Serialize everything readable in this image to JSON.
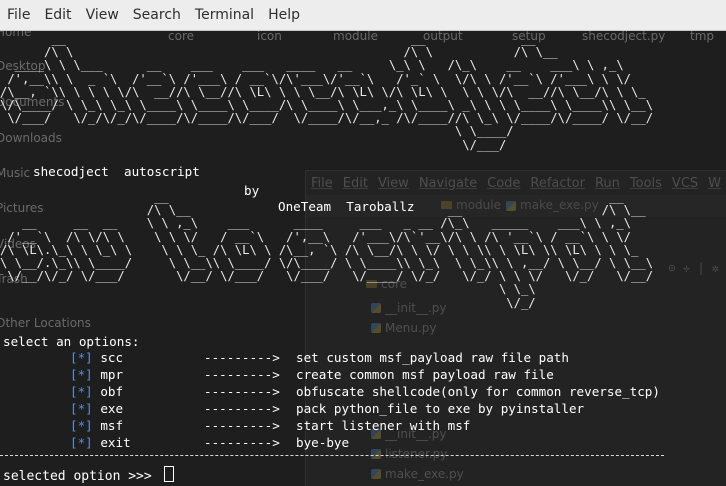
{
  "menu": [
    "File",
    "Edit",
    "View",
    "Search",
    "Terminal",
    "Help"
  ],
  "ghost_file_manager": {
    "sidebar": [
      "Home",
      "Desktop",
      "Documents",
      "Downloads",
      "Music",
      "Pictures",
      "Videos",
      "Trash",
      "Other Locations"
    ],
    "folders": [
      "core",
      "icon",
      "module",
      "output",
      "setup",
      "shecodject.py",
      "tmp"
    ]
  },
  "ghost_ide": {
    "menu": [
      "File",
      "Edit",
      "View",
      "Navigate",
      "Code",
      "Refactor",
      "Run",
      "Tools",
      "VCS",
      "W"
    ],
    "crumbs": [
      "module",
      "make_exe.py"
    ],
    "tree": [
      "core",
      "__init__.py",
      "Menu.py",
      "__init__.py",
      "__init__.py",
      "listener.py",
      "make_exe.py"
    ]
  },
  "terminal": {
    "banner_art_top": "       __                                               __             __\n      /\\ \\                                             /\\ \\           /\\ \\__\n  ____\\ \\ \\___      __    ___    ___   ____   __     \\_\\ \\   /\\_\\    __    ___\\ \\ ,_\\\n /',__\\\\ \\  _ `\\  /'__`\\ /'___\\ / __`\\/\\'___\\/'__`\\   /'_` \\  \\/\\ \\ /'__`\\ /'___\\ \\ \\/\n/\\__, `\\\\ \\ \\ \\ \\/\\  __//\\ \\__//\\ \\L\\ \\ \\ \\__/\\ \\L\\ \\/\\ \\L\\ \\  \\ \\ \\/\\  __//\\ \\__/\\ \\ \\_\n\\/\\____/ \\ \\_\\ \\_\\ \\____\\ \\____\\ \\____/\\ \\____\\ \\___,_\\ \\____\\ _\\ \\ \\ \\____\\ \\____\\\\ \\__\\\n \\/___/   \\/_/\\/_/\\/____/\\/____/\\/___/  \\/____/\\/__,_ /\\/____//\\ \\_\\ \\/____/\\/____/ \\/__/\n                                                              \\ \\____/\n                                                               \\/___/",
    "title": "shecodject  autoscript",
    "by": "by",
    "author": "OneTeam  Taroballz",
    "banner_art_bottom": "                     __                                                            __\n                    /\\ \\__                                   __                   /\\ \\__\n   __     __  __    \\ \\ ,_\\    ___      ____     ___   _ __ /\\_\\   _____    ___\\ \\ ,_\\\n /'__`\\  /\\ \\/\\ \\    \\ \\ \\/   / __`\\   /',__\\   /'___\\/\\`'__\\/\\ \\ /\\ '__`\\ / __`\\ \\ \\/\n/\\ \\L\\.\\_\\ \\ \\_\\ \\    \\ \\ \\_ /\\ \\L\\ \\ /\\__, `\\ /\\ \\__/\\ \\ \\/ \\ \\ \\\\ \\ \\L\\ \\\\ \\L\\ \\ \\ \\_\n\\ \\__/.\\_\\\\ \\____/     \\ \\__\\\\ \\____/ \\/\\____/ \\ \\____\\\\ \\_\\  \\ \\_\\\\ \\ ,__/ \\ \\__/ \\ \\__\\\n \\/__/\\/_/ \\/___/       \\/__/ \\/___/   \\/___/   \\/____/ \\/_/   \\/_/ \\ \\ \\/   \\/_/   \\/__/\n                                                                    \\ \\_\\\n                                                                     \\/_/",
    "select_prompt": "select an options:",
    "options": [
      {
        "tag": "[*]",
        "key": "scc",
        "arrow": "--------->",
        "desc": "set custom msf_payload raw file path"
      },
      {
        "tag": "[*]",
        "key": "mpr",
        "arrow": "--------->",
        "desc": "create common msf payload raw file"
      },
      {
        "tag": "[*]",
        "key": "obf",
        "arrow": "--------->",
        "desc": "obfuscate shellcode(only for common reverse_tcp)"
      },
      {
        "tag": "[*]",
        "key": "exe",
        "arrow": "--------->",
        "desc": "pack python_file to exe by pyinstaller"
      },
      {
        "tag": "[*]",
        "key": "msf",
        "arrow": "--------->",
        "desc": "start listener with msf"
      },
      {
        "tag": "[*]",
        "key": "exit",
        "arrow": "--------->",
        "desc": "bye-bye"
      }
    ],
    "input_prompt": "selected option >>> "
  }
}
